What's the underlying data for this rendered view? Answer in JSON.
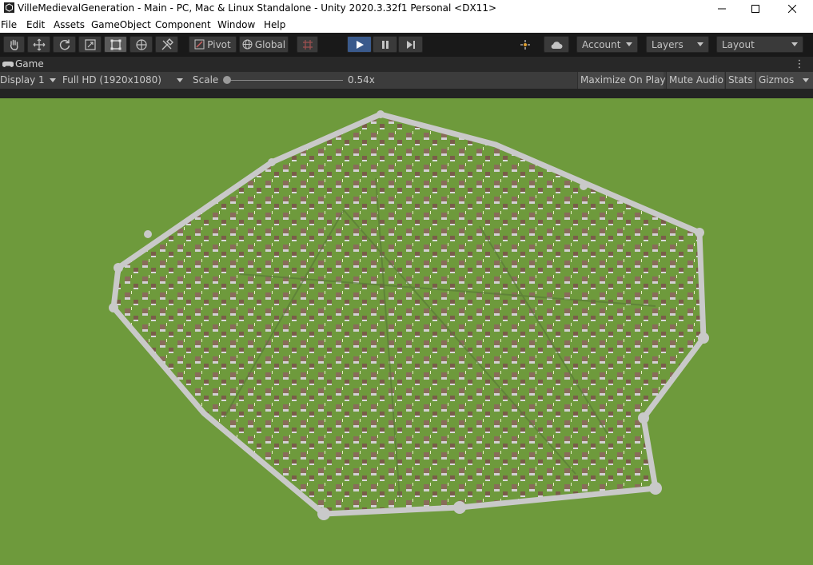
{
  "window": {
    "title": "VilleMedievalGeneration - Main - PC, Mac & Linux Standalone - Unity 2020.3.32f1 Personal <DX11>"
  },
  "menu": [
    "File",
    "Edit",
    "Assets",
    "GameObject",
    "Component",
    "Window",
    "Help"
  ],
  "toolbar": {
    "pivot_label": "Pivot",
    "global_label": "Global",
    "account_label": "Account",
    "layers_label": "Layers",
    "layout_label": "Layout"
  },
  "game_panel": {
    "tab_label": "Game",
    "display": "Display 1",
    "resolution": "Full HD (1920x1080)",
    "scale_label": "Scale",
    "scale_value": "0.54x",
    "scale_fraction": 0.0,
    "buttons": [
      "Maximize On Play",
      "Mute Audio",
      "Stats",
      "Gizmos"
    ]
  },
  "colors": {
    "grass": "#6e9a3c",
    "wall": "#c9c9c9",
    "house_roof": "#7a5a4a",
    "play_active": "#3a5a8c"
  },
  "icons": [
    "unity-app-icon",
    "minimize-icon",
    "maximize-icon",
    "close-icon",
    "hand-icon",
    "move-icon",
    "rotate-icon",
    "scale-icon",
    "rect-icon",
    "transform-icon",
    "custom-tool-icon",
    "grid-snap-icon",
    "play-icon",
    "pause-icon",
    "step-icon",
    "collab-icon",
    "cloud-icon",
    "gamepad-icon",
    "more-icon"
  ]
}
